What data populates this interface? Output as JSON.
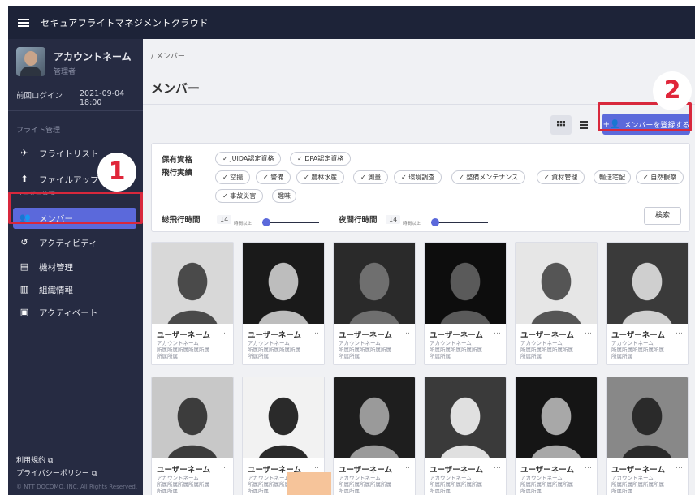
{
  "app": {
    "title": "セキュアフライトマネジメントクラウド"
  },
  "account": {
    "name": "アカウントネーム",
    "role": "管理者",
    "last_login_label": "前回ログイン",
    "last_login_date": "2021-09-04 18:00"
  },
  "sidebar": {
    "section": "フライト管理",
    "hidden_section": "ユーザー管理",
    "items": [
      {
        "label": "フライトリスト",
        "icon": "plane-icon"
      },
      {
        "label": "ファイルアップ",
        "icon": "upload-icon"
      },
      {
        "label": "メンバー",
        "icon": "members-icon"
      },
      {
        "label": "アクティビティ",
        "icon": "history-icon"
      },
      {
        "label": "機材管理",
        "icon": "clipboard-icon"
      },
      {
        "label": "組織情報",
        "icon": "org-icon"
      },
      {
        "label": "アクティベート",
        "icon": "activate-icon"
      }
    ],
    "footer": {
      "terms": "利用規約",
      "privacy": "プライバシーポリシー",
      "copyright": "© NTT DOCOMO, INC. All Rights Reserved."
    }
  },
  "main": {
    "breadcrumb": "/ メンバー",
    "title": "メンバー",
    "register_label": "メンバーを登録する",
    "filter": {
      "qual_label": "保有資格",
      "record_label": "飛行実績",
      "quals": [
        "JUIDA認定資格",
        "DPA認定資格"
      ],
      "records": [
        "空撮",
        "警備",
        "農林水産",
        "測量",
        "環境調査",
        "整備メンテナンス",
        "資材管理",
        "輸送宅配",
        "自然観察",
        "事故災害",
        "趣味"
      ],
      "total_label": "総飛行時間",
      "total_value": "14",
      "total_unit": "時間以上",
      "night_label": "夜間行時間",
      "night_value": "14",
      "night_unit": "時間以上",
      "search_label": "検索"
    },
    "card": {
      "name": "ユーザーネーム",
      "more": "…",
      "sub1": "アカウントネーム",
      "sub2": "所属所属所属所属所属",
      "sub3": "所属所属"
    }
  },
  "annotations": {
    "badge1": "1",
    "badge2": "2"
  },
  "colors": {
    "accent": "#5b69db",
    "topbar": "#1d2338",
    "sidebar": "#262b42",
    "highlight": "#d8283c"
  }
}
